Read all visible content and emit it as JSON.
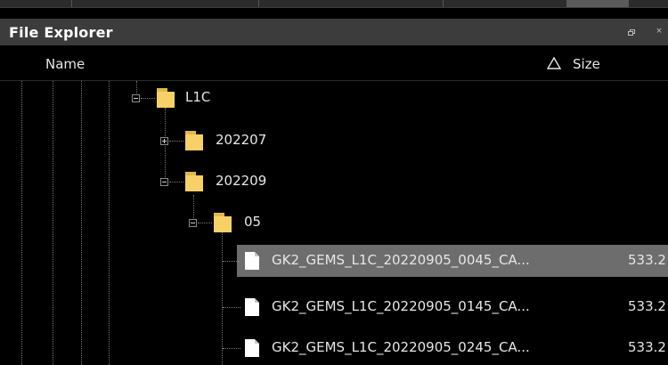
{
  "panel": {
    "title": "File Explorer",
    "restore_icon": "restore-icon",
    "close_label": "×"
  },
  "columns": {
    "name": "Name",
    "size": "Size",
    "sort_icon": "sort-ascending-icon"
  },
  "tree": {
    "folders": [
      {
        "label": "L1C",
        "state": "expanded"
      },
      {
        "label": "202207",
        "state": "collapsed"
      },
      {
        "label": "202209",
        "state": "expanded"
      },
      {
        "label": "05",
        "state": "expanded"
      }
    ],
    "files": [
      {
        "name": "GK2_GEMS_L1C_20220905_0045_CA...",
        "size": "533.2",
        "selected": true
      },
      {
        "name": "GK2_GEMS_L1C_20220905_0145_CA...",
        "size": "533.2",
        "selected": false
      },
      {
        "name": "GK2_GEMS_L1C_20220905_0245_CA...",
        "size": "533.2",
        "selected": false
      }
    ]
  },
  "colors": {
    "background": "#000000",
    "title_bar": "#3c3c3c",
    "selection": "#6d6d6d",
    "folder": "#f7d167",
    "text": "#e6e6e6"
  }
}
